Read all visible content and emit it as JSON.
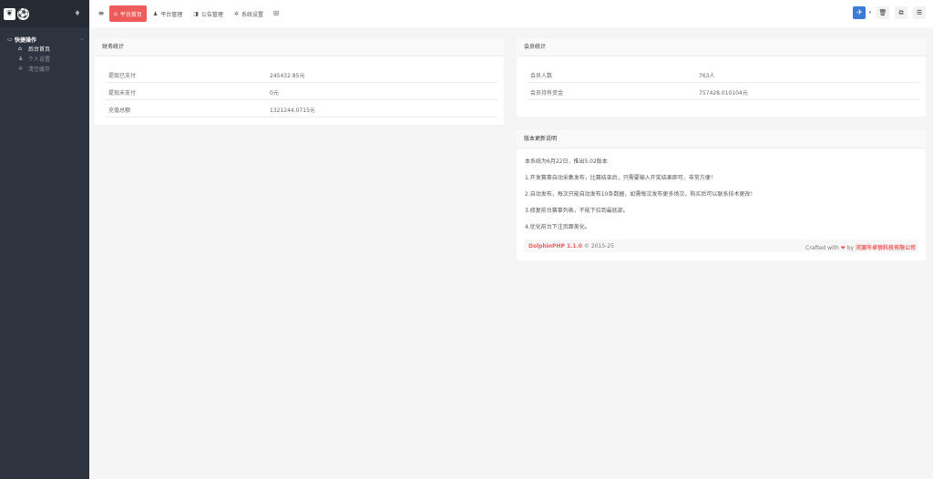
{
  "sidebar": {
    "logo_a": "❦",
    "logo_b": "⚽",
    "drop_icon": "♦",
    "section": {
      "icon": "folder-open-icon",
      "icon_glyph": "▭",
      "title": "快捷操作",
      "caret": "⌄"
    },
    "items": [
      {
        "icon_glyph": "⌂",
        "label": "后台首页",
        "active": true
      },
      {
        "icon_glyph": "♟",
        "label": "个人设置",
        "active": false
      },
      {
        "icon_glyph": "✲",
        "label": "清空缓存",
        "active": false
      }
    ]
  },
  "header": {
    "menu_glyph": "≡",
    "tabs": [
      {
        "icon_glyph": "⌂",
        "label": "平台首页"
      },
      {
        "icon_glyph": "♟",
        "label": "平台管理"
      },
      {
        "icon_glyph": "◨",
        "label": "公告管理"
      },
      {
        "icon_glyph": "✲",
        "label": "系统设置"
      }
    ],
    "grid_glyph": "⊞",
    "avatar_glyph": "✈",
    "avatar_caret": "▾",
    "right_buttons": [
      "🗑",
      "⧉",
      "☰"
    ]
  },
  "finance": {
    "title": "财务统计",
    "rows": [
      {
        "label": "提现已支付",
        "value": "245432.85元"
      },
      {
        "label": "提现未支付",
        "value": "0元"
      },
      {
        "label": "充值总额",
        "value": "1321244.0715元"
      }
    ]
  },
  "members": {
    "title": "会员统计",
    "rows": [
      {
        "label": "会员人数",
        "value": "763人"
      },
      {
        "label": "会员持有资金",
        "value": "757428.010104元"
      }
    ]
  },
  "version": {
    "title": "版本更新说明",
    "lines": [
      "本系统为6月22日，推出5.02版本",
      "1.开发赛事自动采集发布，比赛结束后，只需要输入开奖结果即可，非常方便！",
      "2.自动发布，每次只能自动发布10条数据，如需每次发布更多场次，购买后可以联系技术更改！",
      "3.修复前台赛事列表，不能下拉到最底部。",
      "4.优化前台下注页面美化。"
    ],
    "footer_left_brand": "DolphinPHP 1.1.0",
    "footer_left_rest": " © 2015-25",
    "footer_right_prefix": "Crafted with ",
    "footer_right_heart": "❤",
    "footer_right_by": " by ",
    "footer_right_company": "河源市卓锐科技有限公司"
  }
}
